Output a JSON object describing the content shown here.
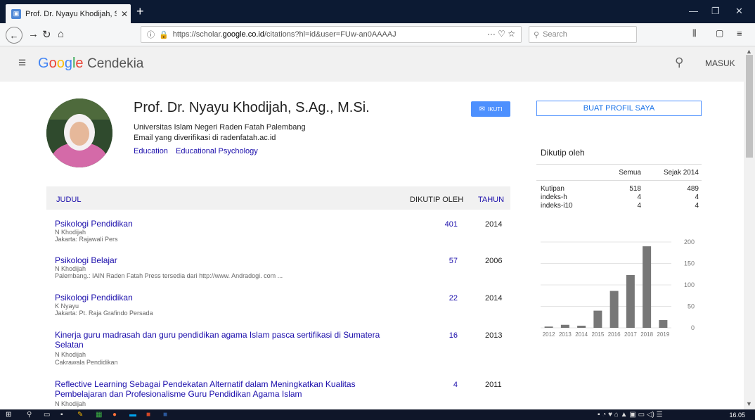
{
  "browser": {
    "tab_title": "Prof. Dr. Nyayu Khodijah, S.Ag. | X",
    "tab_title_text": "Prof. Dr. Nyayu Khodijah, S.Ag.",
    "url_prefix": "https://scholar.",
    "url_domain": "google.co.id",
    "url_suffix": "/citations?hl=id&user=FUw-an0AAAAJ",
    "search_placeholder": "Search"
  },
  "header": {
    "brand": "Google",
    "product": "Cendekia",
    "signin": "MASUK"
  },
  "profile": {
    "name": "Prof. Dr. Nyayu Khodijah, S.Ag., M.Si.",
    "affiliation": "Universitas Islam Negeri Raden Fatah Palembang",
    "email": "Email yang diverifikasi di radenfatah.ac.id",
    "interests": [
      "Education",
      "Educational Psychology"
    ],
    "follow_label": "IKUTI"
  },
  "create_profile": "BUAT PROFIL SAYA",
  "table": {
    "col_title": "JUDUL",
    "col_cited": "DIKUTIP OLEH",
    "col_year": "TAHUN",
    "rows": [
      {
        "title": "Psikologi Pendidikan",
        "author": "N Khodijah",
        "pub": "Jakarta: Rajawali Pers",
        "cited": "401",
        "year": "2014"
      },
      {
        "title": "Psikologi Belajar",
        "author": "N Khodijah",
        "pub": "Palembang.: IAIN Raden Fatah Press tersedia dari http://www. Andradogi. com ...",
        "cited": "57",
        "year": "2006"
      },
      {
        "title": "Psikologi Pendidikan",
        "author": "K Nyayu",
        "pub": "Jakarta: Pt. Raja Grafindo Persada",
        "cited": "22",
        "year": "2014"
      },
      {
        "title": "Kinerja guru madrasah dan guru pendidikan agama Islam pasca sertifikasi di Sumatera Selatan",
        "author": "N Khodijah",
        "pub": "Cakrawala Pendidikan",
        "cited": "16",
        "year": "2013"
      },
      {
        "title": "Reflective Learning Sebagai Pendekatan Alternatif dalam Meningkatkan Kualitas Pembelajaran dan Profesionalisme Guru Pendidikan Agama Islam",
        "author": "N Khodijah",
        "pub": "",
        "cited": "4",
        "year": "2011"
      }
    ]
  },
  "cited_by": {
    "label": "Dikutip oleh",
    "col_all": "Semua",
    "col_since": "Sejak 2014",
    "rows": [
      {
        "metric": "Kutipan",
        "all": "518",
        "since": "489"
      },
      {
        "metric": "indeks-h",
        "all": "4",
        "since": "4"
      },
      {
        "metric": "indeks-i10",
        "all": "4",
        "since": "4"
      }
    ]
  },
  "chart_data": {
    "type": "bar",
    "categories": [
      "2012",
      "2013",
      "2014",
      "2015",
      "2016",
      "2017",
      "2018",
      "2019"
    ],
    "values": [
      3,
      7,
      5,
      40,
      86,
      123,
      190,
      18
    ],
    "ylim": [
      0,
      200
    ],
    "yticks": [
      0,
      50,
      100,
      150,
      200
    ],
    "bar_color": "#777777"
  },
  "taskbar": {
    "clock": "16.05"
  }
}
